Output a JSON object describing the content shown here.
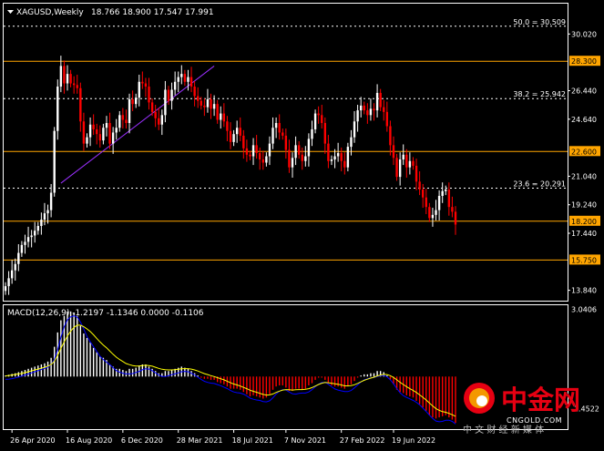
{
  "header": {
    "symbol_label": "XAGUSD,Weekly",
    "ohlc_label": "18.766 18.900 17.547 17.991"
  },
  "colors": {
    "background": "#000000",
    "bull_candle": "#ffffff",
    "bear_candle": "#ff0000",
    "level_line": "#ffa500",
    "fib_line": "#ffffff",
    "trendline": "#9b30ff",
    "macd_line": "#0000ff",
    "signal_line": "#ffff00",
    "axis_text": "#ffffff",
    "brand_red": "#e60012",
    "brand_orange": "#f39800"
  },
  "price_axis": {
    "labels": [
      "30.020",
      "28.300",
      "26.440",
      "24.640",
      "22.600",
      "21.040",
      "19.240",
      "18.200",
      "17.440",
      "15.750",
      "13.840"
    ],
    "highlighted_labels": [
      "28.300",
      "22.600",
      "18.200",
      "15.750"
    ]
  },
  "chart_data": [
    {
      "type": "candlestick",
      "title": "XAGUSD,Weekly",
      "ohlc_last": {
        "open": 18.766,
        "high": 18.9,
        "low": 17.547,
        "close": 17.991
      },
      "ylim": [
        13.3,
        30.9
      ],
      "y_ticks": [
        30.02,
        28.3,
        26.44,
        24.64,
        22.6,
        21.04,
        19.24,
        18.2,
        17.44,
        15.75,
        13.84
      ],
      "x_tick_labels": [
        "26 Apr 2020",
        "16 Aug 2020",
        "6 Dec 2020",
        "28 Mar 2021",
        "18 Jul 2021",
        "7 Nov 2021",
        "27 Feb 2022",
        "19 Jun 2022"
      ],
      "horizontal_levels": [
        28.3,
        22.6,
        18.2,
        15.75
      ],
      "fibonacci_levels": [
        {
          "label": "50.0 = 30.509",
          "value": 30.509
        },
        {
          "label": "38.2 = 25.942",
          "value": 25.942
        },
        {
          "label": "23.6 = 20.291",
          "value": 20.291
        }
      ],
      "trendline": {
        "from": {
          "week": 17,
          "price": 20.6
        },
        "to": {
          "week": 64,
          "price": 28.0
        }
      },
      "closes": [
        14.1,
        14.6,
        15.1,
        15.5,
        16.2,
        16.7,
        16.9,
        17.2,
        17.3,
        17.6,
        17.9,
        18.3,
        18.7,
        18.9,
        20.0,
        23.9,
        26.7,
        28.0,
        26.9,
        27.5,
        26.9,
        26.8,
        26.6,
        24.5,
        23.1,
        23.5,
        24.3,
        24.0,
        23.7,
        23.3,
        24.1,
        24.4,
        23.1,
        23.8,
        24.1,
        24.9,
        24.6,
        24.4,
        25.9,
        25.6,
        26.0,
        27.0,
        26.9,
        26.7,
        25.7,
        25.1,
        24.7,
        24.3,
        24.9,
        26.5,
        25.8,
        26.5,
        27.0,
        27.3,
        27.5,
        27.0,
        27.3,
        26.7,
        26.1,
        25.8,
        25.5,
        25.4,
        25.9,
        25.3,
        25.6,
        24.6,
        25.0,
        24.5,
        23.9,
        23.2,
        23.7,
        24.1,
        23.6,
        22.8,
        22.4,
        22.3,
        23.0,
        22.5,
        22.1,
        21.9,
        22.3,
        23.1,
        24.1,
        24.4,
        23.8,
        23.6,
        22.7,
        21.6,
        22.2,
        23.0,
        22.4,
        22.0,
        22.3,
        23.4,
        24.0,
        25.0,
        24.9,
        24.4,
        23.1,
        22.0,
        22.1,
        22.3,
        22.5,
        22.0,
        21.6,
        22.9,
        23.5,
        24.5,
        25.2,
        25.5,
        25.2,
        24.9,
        25.3,
        25.2,
        26.3,
        25.4,
        25.1,
        24.2,
        23.0,
        22.2,
        21.0,
        22.1,
        22.4,
        21.6,
        22.0,
        21.7,
        20.7,
        20.2,
        19.7,
        19.1,
        18.4,
        18.6,
        18.9,
        19.8,
        20.1,
        20.2,
        19.1,
        18.8,
        17.99
      ],
      "series": [
        {
          "name": "MACD(12,26,9)",
          "type": "histogram",
          "values": [
            0.05,
            0.08,
            0.12,
            0.15,
            0.2,
            0.25,
            0.3,
            0.35,
            0.4,
            0.45,
            0.5,
            0.55,
            0.6,
            0.68,
            0.85,
            1.35,
            2.0,
            2.55,
            2.75,
            2.95,
            2.95,
            2.9,
            2.75,
            2.3,
            1.95,
            1.75,
            1.55,
            1.3,
            1.1,
            0.9,
            0.85,
            0.75,
            0.55,
            0.45,
            0.35,
            0.35,
            0.3,
            0.25,
            0.35,
            0.35,
            0.4,
            0.5,
            0.55,
            0.55,
            0.45,
            0.35,
            0.25,
            0.15,
            0.15,
            0.25,
            0.25,
            0.3,
            0.35,
            0.4,
            0.45,
            0.4,
            0.35,
            0.25,
            0.15,
            0.05,
            -0.05,
            -0.1,
            -0.1,
            -0.15,
            -0.15,
            -0.25,
            -0.3,
            -0.35,
            -0.45,
            -0.55,
            -0.55,
            -0.55,
            -0.6,
            -0.7,
            -0.8,
            -0.9,
            -0.85,
            -0.9,
            -0.95,
            -1.0,
            -0.95,
            -0.8,
            -0.6,
            -0.45,
            -0.4,
            -0.4,
            -0.5,
            -0.65,
            -0.65,
            -0.55,
            -0.55,
            -0.6,
            -0.55,
            -0.4,
            -0.3,
            -0.15,
            -0.05,
            -0.05,
            -0.15,
            -0.3,
            -0.4,
            -0.45,
            -0.45,
            -0.5,
            -0.55,
            -0.45,
            -0.35,
            -0.2,
            -0.05,
            0.05,
            0.1,
            0.1,
            0.15,
            0.15,
            0.25,
            0.25,
            0.2,
            0.05,
            -0.15,
            -0.35,
            -0.6,
            -0.7,
            -0.75,
            -0.85,
            -0.9,
            -0.95,
            -1.1,
            -1.25,
            -1.4,
            -1.55,
            -1.75,
            -1.85,
            -1.9,
            -1.85,
            -1.8,
            -1.75,
            -1.85,
            -1.95,
            -2.1
          ]
        },
        {
          "name": "Signal",
          "type": "line",
          "values": [
            0.03,
            0.05,
            0.07,
            0.1,
            0.12,
            0.15,
            0.18,
            0.22,
            0.26,
            0.3,
            0.34,
            0.38,
            0.42,
            0.47,
            0.54,
            0.7,
            0.96,
            1.28,
            1.57,
            1.84,
            2.06,
            2.23,
            2.33,
            2.33,
            2.26,
            2.16,
            2.04,
            1.89,
            1.73,
            1.57,
            1.43,
            1.3,
            1.15,
            1.01,
            0.88,
            0.77,
            0.68,
            0.59,
            0.54,
            0.5,
            0.48,
            0.48,
            0.5,
            0.51,
            0.5,
            0.47,
            0.42,
            0.37,
            0.33,
            0.31,
            0.3,
            0.3,
            0.31,
            0.33,
            0.35,
            0.36,
            0.36,
            0.34,
            0.3,
            0.25,
            0.19,
            0.13,
            0.09,
            0.04,
            0.0,
            -0.05,
            -0.1,
            -0.15,
            -0.21,
            -0.28,
            -0.34,
            -0.38,
            -0.43,
            -0.49,
            -0.55,
            -0.62,
            -0.67,
            -0.71,
            -0.76,
            -0.81,
            -0.84,
            -0.83,
            -0.79,
            -0.72,
            -0.66,
            -0.61,
            -0.59,
            -0.6,
            -0.61,
            -0.6,
            -0.59,
            -0.59,
            -0.58,
            -0.55,
            -0.5,
            -0.43,
            -0.36,
            -0.3,
            -0.27,
            -0.28,
            -0.3,
            -0.33,
            -0.35,
            -0.38,
            -0.42,
            -0.42,
            -0.41,
            -0.37,
            -0.31,
            -0.24,
            -0.17,
            -0.12,
            -0.07,
            -0.03,
            0.03,
            0.07,
            0.1,
            0.09,
            0.04,
            -0.04,
            -0.15,
            -0.26,
            -0.36,
            -0.46,
            -0.55,
            -0.63,
            -0.72,
            -0.83,
            -0.94,
            -1.06,
            -1.2,
            -1.33,
            -1.45,
            -1.53,
            -1.59,
            -1.62,
            -1.67,
            -1.73,
            -1.8
          ]
        }
      ],
      "histogram_colors": {
        "positive": "#ffffff",
        "negative": "#ff0000"
      }
    },
    {
      "type": "bar",
      "title": "MACD(12,26,9) -1.2197 -1.1346 0.0000 -0.1106",
      "ylim": [
        -2.3,
        3.15
      ],
      "y_ticks": [
        3.0406,
        -1.4522
      ],
      "y_tick_labels": [
        "3.0406",
        "-1.4522"
      ]
    }
  ],
  "macd_panel": {
    "label": "MACD(12,26,9) -1.2197 -1.1346 0.0000 -0.1106",
    "axis_labels": [
      "3.0406",
      "-1.4522"
    ]
  },
  "time_axis": {
    "labels": [
      "26 Apr 2020",
      "16 Aug 2020",
      "6 Dec 2020",
      "28 Mar 2021",
      "18 Jul 2021",
      "7 Nov 2021",
      "27 Feb 2022",
      "19 Jun 2022"
    ]
  },
  "watermark": {
    "logo_text": "中金网",
    "url_text": "CNGOLD.COM",
    "tagline": "中 文 财 经 新 媒 体"
  }
}
